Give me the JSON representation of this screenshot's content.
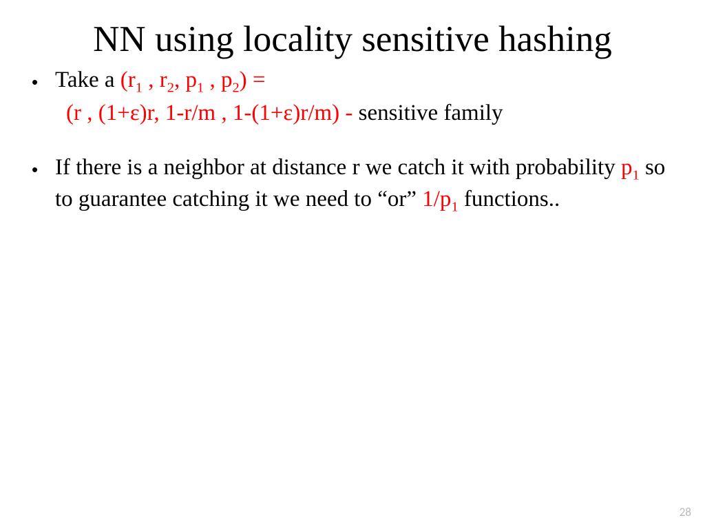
{
  "title": "NN using locality sensitive hashing",
  "bullet1": {
    "lead": "Take a ",
    "tuple_open": "(r",
    "s1": "1",
    "sep1": " , r",
    "s2": "2",
    "sep2": ", p",
    "s3": "1",
    "sep3": " , p",
    "s4": "2",
    "tuple_close": ") ="
  },
  "line2": {
    "red_part": "(r , (1+ε)r, 1-r/m , 1-(1+ε)r/m) - ",
    "black_part": "sensitive family"
  },
  "bullet2": {
    "part1": "If there is a neighbor at distance r we catch it with probability ",
    "p1": "p",
    "p1_sub": "1",
    "part2": " so to guarantee catching it we need to “or” ",
    "inv": "1/p",
    "inv_sub": "1",
    "part3": " functions.."
  },
  "page_number": "28"
}
